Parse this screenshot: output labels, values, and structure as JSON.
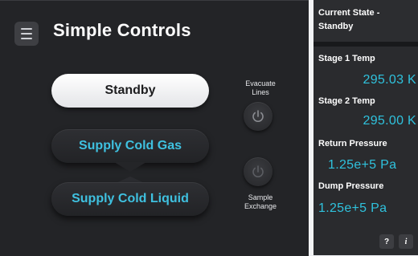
{
  "header": {
    "title": "Simple Controls",
    "menu_icon": "hamburger-menu-icon"
  },
  "controls": {
    "standby_label": "Standby",
    "supply_gas_label": "Supply Cold Gas",
    "supply_liquid_label": "Supply Cold Liquid",
    "evacuate_label_line1": "Evacuate",
    "evacuate_label_line2": "Lines",
    "sample_label_line1": "Sample",
    "sample_label_line2": "Exchange",
    "power_icon": "power-icon"
  },
  "status": {
    "current_state_line1": "Current State -",
    "current_state_line2": "Standby"
  },
  "readings": {
    "stage1_label": "Stage 1 Temp",
    "stage1_value": "295.03 K",
    "stage2_label": "Stage 2 Temp",
    "stage2_value": "295.00 K",
    "return_label": "Return Pressure",
    "return_value": "1.25e+5 Pa",
    "dump_label": "Dump Pressure",
    "dump_value": "1.25e+5 Pa"
  },
  "help": {
    "question_label": "?",
    "info_label": "i"
  },
  "colors": {
    "accent_cyan": "#2fc2dd",
    "panel_dark": "#232427",
    "standby_pill": "#ffffff"
  }
}
